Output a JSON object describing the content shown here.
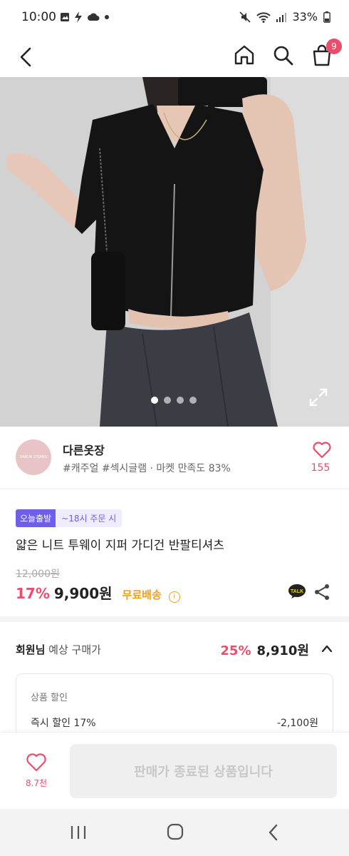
{
  "status_bar": {
    "time": "10:00",
    "battery": "33%"
  },
  "top_nav": {
    "cart_count": "9"
  },
  "carousel": {
    "total": 4,
    "active_index": 0
  },
  "seller": {
    "name": "다른옷장",
    "avatar_text": "DARUN OTJANG",
    "tags": "#캐주얼 #섹시글램 · 마켓 만족도 83%",
    "like_count": "155"
  },
  "product": {
    "badge_today": "오늘출발",
    "badge_time": "~18시 주문 시",
    "title": "얇은 니트 투웨이 지퍼 가디건 반팔티셔츠",
    "original_price": "12,000원",
    "discount_rate": "17%",
    "sale_price": "9,900원",
    "free_shipping": "무료배송"
  },
  "member": {
    "label_bold": "회원님",
    "label_rest": " 예상 구매가",
    "discount_rate": "25%",
    "price": "8,910원",
    "section_title": "상품 할인",
    "row_label": "즉시 할인 17%",
    "row_amount": "-2,100원"
  },
  "action_bar": {
    "wish_count": "8.7천",
    "soldout_label": "판매가 종료된 상품입니다"
  },
  "colors": {
    "accent": "#ee4c6b",
    "purple": "#6e5ee8",
    "shipping": "#f0a020"
  }
}
